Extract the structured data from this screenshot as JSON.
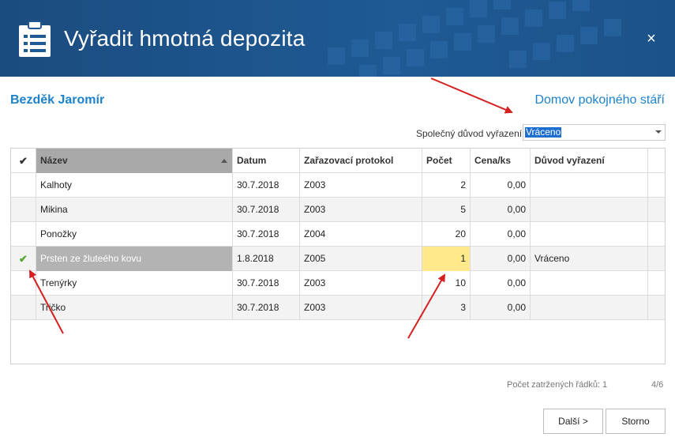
{
  "dialog": {
    "title": "Vyřadit hmotná depozita",
    "close_glyph": "×",
    "icon": "clipboard-list-icon"
  },
  "person_name": "Bezděk Jaromír",
  "facility_name": "Domov pokojného stáří",
  "common_reason": {
    "label": "Společný důvod vyřazení:",
    "value": "Vráceno"
  },
  "table": {
    "check_header_glyph": "✔",
    "columns": [
      "Název",
      "Datum",
      "Zařazovací protokol",
      "Počet",
      "Cena/ks",
      "Důvod vyřazení"
    ],
    "rows": [
      {
        "checked": "",
        "name": "Kalhoty",
        "date": "30.7.2018",
        "protocol": "Z003",
        "count": "2",
        "price": "0,00",
        "reason": ""
      },
      {
        "checked": "",
        "name": "Mikina",
        "date": "30.7.2018",
        "protocol": "Z003",
        "count": "5",
        "price": "0,00",
        "reason": ""
      },
      {
        "checked": "",
        "name": "Ponožky",
        "date": "30.7.2018",
        "protocol": "Z004",
        "count": "20",
        "price": "0,00",
        "reason": ""
      },
      {
        "checked": "✔",
        "name": "Prsten ze žluteého kovu",
        "date": "1.8.2018",
        "protocol": "Z005",
        "count": "1",
        "price": "0,00",
        "reason": "Vráceno"
      },
      {
        "checked": "",
        "name": "Trenýrky",
        "date": "30.7.2018",
        "protocol": "Z003",
        "count": "10",
        "price": "0,00",
        "reason": ""
      },
      {
        "checked": "",
        "name": "Tričko",
        "date": "30.7.2018",
        "protocol": "Z003",
        "count": "3",
        "price": "0,00",
        "reason": ""
      }
    ]
  },
  "footer": {
    "selected_count": "Počet zatržených řádků: 1",
    "pager": "4/6"
  },
  "buttons": {
    "next": "Další >",
    "cancel": "Storno"
  },
  "colors": {
    "header_bg": "#1f5a94",
    "accent": "#1c82c9",
    "check": "#55a630",
    "highlight_cell": "#ffe98a",
    "annotation_arrow": "#d42020"
  }
}
